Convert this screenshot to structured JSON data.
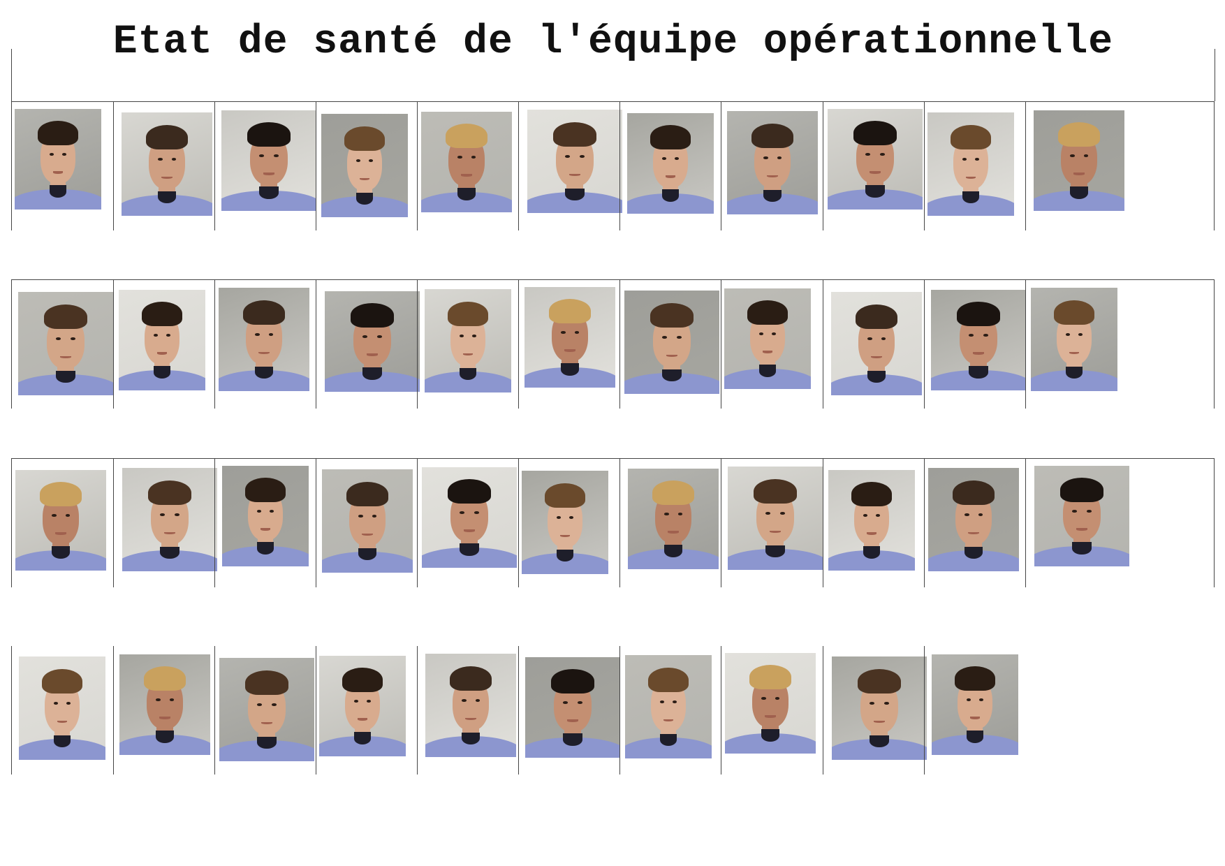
{
  "page": {
    "title": "Etat de santé de l'équipe opérationnelle"
  },
  "colors": {
    "background": "#ffffff",
    "grid_lines": "#444444",
    "uniform_shirt": "#8c96cf",
    "photo_background_grey": "#a9a9a4"
  },
  "rows": [
    {
      "photo_count": 11
    },
    {
      "photo_count": 11
    },
    {
      "photo_count": 11
    },
    {
      "photo_count": 10
    }
  ],
  "total_photos": 43
}
